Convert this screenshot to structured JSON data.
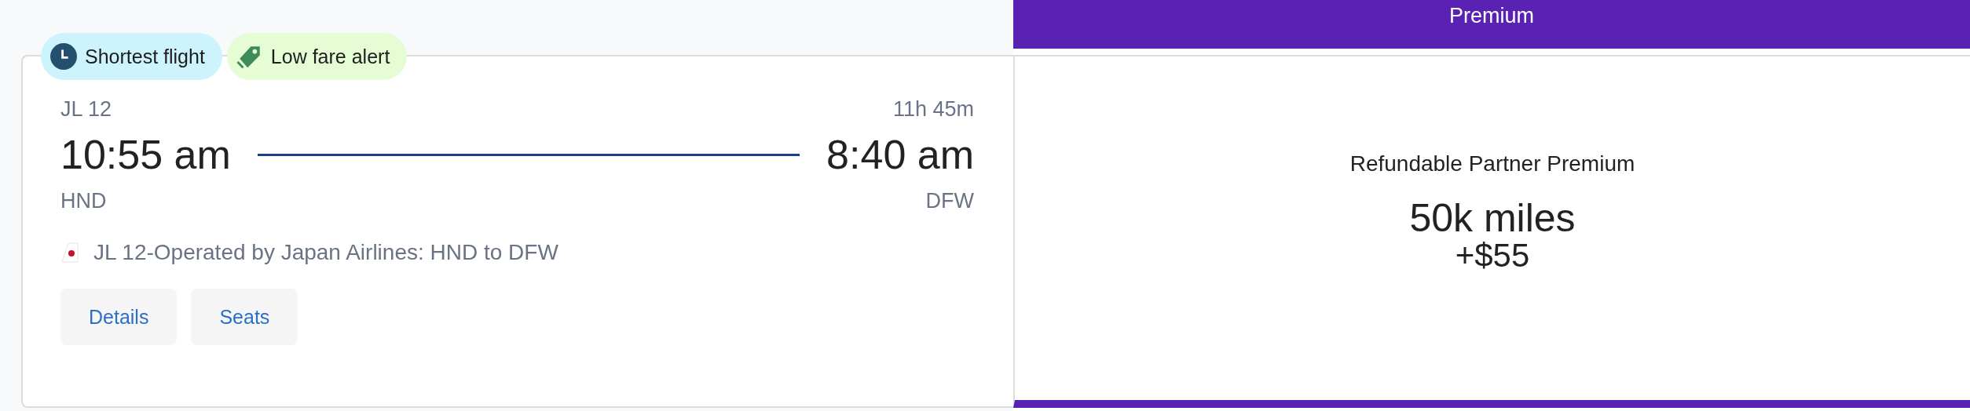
{
  "badges": [
    {
      "kind": "shortest",
      "label": "Shortest flight"
    },
    {
      "kind": "low_fare",
      "label": "Low fare alert"
    }
  ],
  "flight": {
    "number": "JL 12",
    "duration": "11h 45m",
    "depart_time": "10:55 am",
    "arrive_time": "8:40 am",
    "origin": "HND",
    "destination": "DFW",
    "operated_by": "JL 12-Operated by Japan Airlines: HND to DFW"
  },
  "buttons": [
    "Details",
    "Seats"
  ],
  "fare": {
    "cabin": "Premium",
    "name": "Refundable Partner Premium",
    "miles": "50k miles",
    "price": "+$55"
  }
}
